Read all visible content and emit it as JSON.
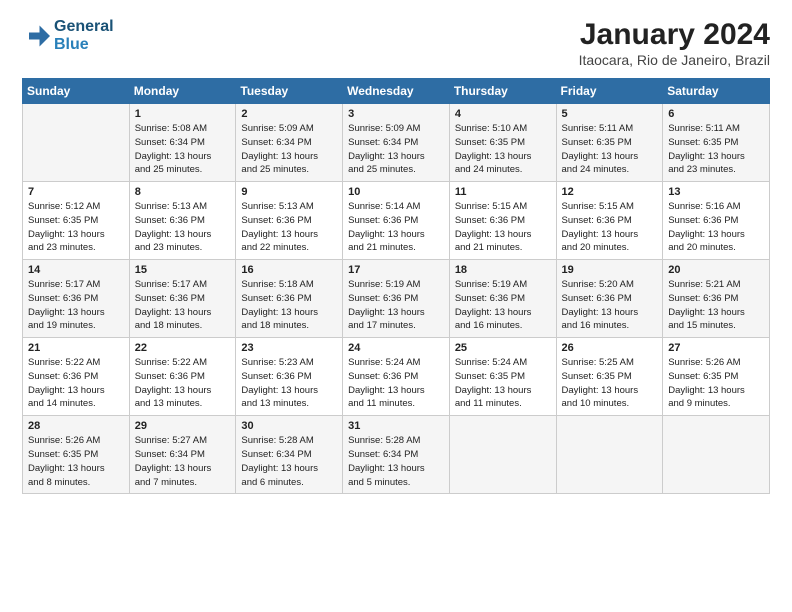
{
  "header": {
    "logo_line1": "General",
    "logo_line2": "Blue",
    "title": "January 2024",
    "subtitle": "Itaocara, Rio de Janeiro, Brazil"
  },
  "weekdays": [
    "Sunday",
    "Monday",
    "Tuesday",
    "Wednesday",
    "Thursday",
    "Friday",
    "Saturday"
  ],
  "weeks": [
    [
      {
        "day": "",
        "info": ""
      },
      {
        "day": "1",
        "info": "Sunrise: 5:08 AM\nSunset: 6:34 PM\nDaylight: 13 hours\nand 25 minutes."
      },
      {
        "day": "2",
        "info": "Sunrise: 5:09 AM\nSunset: 6:34 PM\nDaylight: 13 hours\nand 25 minutes."
      },
      {
        "day": "3",
        "info": "Sunrise: 5:09 AM\nSunset: 6:34 PM\nDaylight: 13 hours\nand 25 minutes."
      },
      {
        "day": "4",
        "info": "Sunrise: 5:10 AM\nSunset: 6:35 PM\nDaylight: 13 hours\nand 24 minutes."
      },
      {
        "day": "5",
        "info": "Sunrise: 5:11 AM\nSunset: 6:35 PM\nDaylight: 13 hours\nand 24 minutes."
      },
      {
        "day": "6",
        "info": "Sunrise: 5:11 AM\nSunset: 6:35 PM\nDaylight: 13 hours\nand 23 minutes."
      }
    ],
    [
      {
        "day": "7",
        "info": "Sunrise: 5:12 AM\nSunset: 6:35 PM\nDaylight: 13 hours\nand 23 minutes."
      },
      {
        "day": "8",
        "info": "Sunrise: 5:13 AM\nSunset: 6:36 PM\nDaylight: 13 hours\nand 23 minutes."
      },
      {
        "day": "9",
        "info": "Sunrise: 5:13 AM\nSunset: 6:36 PM\nDaylight: 13 hours\nand 22 minutes."
      },
      {
        "day": "10",
        "info": "Sunrise: 5:14 AM\nSunset: 6:36 PM\nDaylight: 13 hours\nand 21 minutes."
      },
      {
        "day": "11",
        "info": "Sunrise: 5:15 AM\nSunset: 6:36 PM\nDaylight: 13 hours\nand 21 minutes."
      },
      {
        "day": "12",
        "info": "Sunrise: 5:15 AM\nSunset: 6:36 PM\nDaylight: 13 hours\nand 20 minutes."
      },
      {
        "day": "13",
        "info": "Sunrise: 5:16 AM\nSunset: 6:36 PM\nDaylight: 13 hours\nand 20 minutes."
      }
    ],
    [
      {
        "day": "14",
        "info": "Sunrise: 5:17 AM\nSunset: 6:36 PM\nDaylight: 13 hours\nand 19 minutes."
      },
      {
        "day": "15",
        "info": "Sunrise: 5:17 AM\nSunset: 6:36 PM\nDaylight: 13 hours\nand 18 minutes."
      },
      {
        "day": "16",
        "info": "Sunrise: 5:18 AM\nSunset: 6:36 PM\nDaylight: 13 hours\nand 18 minutes."
      },
      {
        "day": "17",
        "info": "Sunrise: 5:19 AM\nSunset: 6:36 PM\nDaylight: 13 hours\nand 17 minutes."
      },
      {
        "day": "18",
        "info": "Sunrise: 5:19 AM\nSunset: 6:36 PM\nDaylight: 13 hours\nand 16 minutes."
      },
      {
        "day": "19",
        "info": "Sunrise: 5:20 AM\nSunset: 6:36 PM\nDaylight: 13 hours\nand 16 minutes."
      },
      {
        "day": "20",
        "info": "Sunrise: 5:21 AM\nSunset: 6:36 PM\nDaylight: 13 hours\nand 15 minutes."
      }
    ],
    [
      {
        "day": "21",
        "info": "Sunrise: 5:22 AM\nSunset: 6:36 PM\nDaylight: 13 hours\nand 14 minutes."
      },
      {
        "day": "22",
        "info": "Sunrise: 5:22 AM\nSunset: 6:36 PM\nDaylight: 13 hours\nand 13 minutes."
      },
      {
        "day": "23",
        "info": "Sunrise: 5:23 AM\nSunset: 6:36 PM\nDaylight: 13 hours\nand 13 minutes."
      },
      {
        "day": "24",
        "info": "Sunrise: 5:24 AM\nSunset: 6:36 PM\nDaylight: 13 hours\nand 11 minutes."
      },
      {
        "day": "25",
        "info": "Sunrise: 5:24 AM\nSunset: 6:35 PM\nDaylight: 13 hours\nand 11 minutes."
      },
      {
        "day": "26",
        "info": "Sunrise: 5:25 AM\nSunset: 6:35 PM\nDaylight: 13 hours\nand 10 minutes."
      },
      {
        "day": "27",
        "info": "Sunrise: 5:26 AM\nSunset: 6:35 PM\nDaylight: 13 hours\nand 9 minutes."
      }
    ],
    [
      {
        "day": "28",
        "info": "Sunrise: 5:26 AM\nSunset: 6:35 PM\nDaylight: 13 hours\nand 8 minutes."
      },
      {
        "day": "29",
        "info": "Sunrise: 5:27 AM\nSunset: 6:34 PM\nDaylight: 13 hours\nand 7 minutes."
      },
      {
        "day": "30",
        "info": "Sunrise: 5:28 AM\nSunset: 6:34 PM\nDaylight: 13 hours\nand 6 minutes."
      },
      {
        "day": "31",
        "info": "Sunrise: 5:28 AM\nSunset: 6:34 PM\nDaylight: 13 hours\nand 5 minutes."
      },
      {
        "day": "",
        "info": ""
      },
      {
        "day": "",
        "info": ""
      },
      {
        "day": "",
        "info": ""
      }
    ]
  ]
}
